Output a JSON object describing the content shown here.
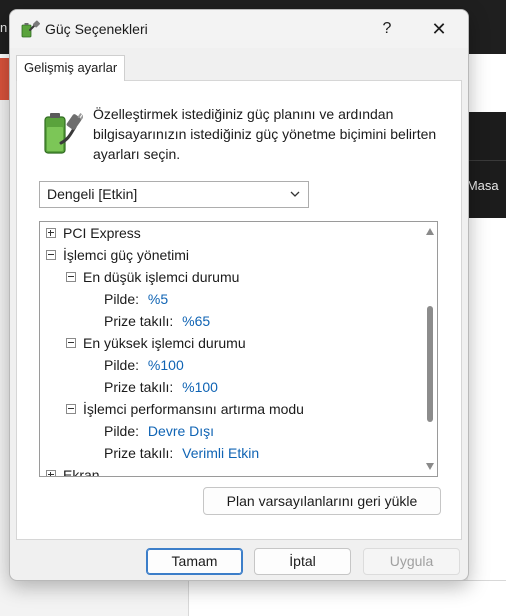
{
  "background": {
    "edge_glyph": "n",
    "right_strip_text": "n Masa"
  },
  "dialog": {
    "title": "Güç Seçenekleri",
    "help_label": "?",
    "close_label": "✕",
    "tab_label": "Gelişmiş ayarlar",
    "description": "Özelleştirmek istediğiniz güç planını ve ardından bilgisayarınızın istediğiniz güç yönetme biçimini belirten ayarları seçin.",
    "plan_select": {
      "selected": "Dengeli [Etkin]"
    },
    "tree": [
      {
        "label": "PCI Express"
      },
      {
        "label": "İşlemci güç yönetimi"
      },
      {
        "label": "En düşük işlemci durumu"
      },
      {
        "label": "Pilde:",
        "value": "%5"
      },
      {
        "label": "Prize takılı:",
        "value": "%65"
      },
      {
        "label": "En yüksek işlemci durumu"
      },
      {
        "label": "Pilde:",
        "value": "%100"
      },
      {
        "label": "Prize takılı:",
        "value": "%100"
      },
      {
        "label": "İşlemci performansını artırma modu"
      },
      {
        "label": "Pilde:",
        "value": "Devre Dışı"
      },
      {
        "label": "Prize takılı:",
        "value": "Verimli Etkin"
      },
      {
        "label": "Ekran"
      }
    ],
    "restore_button": "Plan varsayılanlarını geri yükle",
    "ok_button": "Tamam",
    "cancel_button": "İptal",
    "apply_button": "Uygula"
  },
  "colors": {
    "value_text": "#1064b4",
    "ok_border": "#3c7ec9",
    "dialog_bg": "#f0f0f0"
  },
  "icons": {
    "app": "battery-plug-icon",
    "description": "battery-plug-icon",
    "dropdown": "chevron-down-icon",
    "expand": "plus-box-icon",
    "collapse": "minus-box-icon"
  }
}
